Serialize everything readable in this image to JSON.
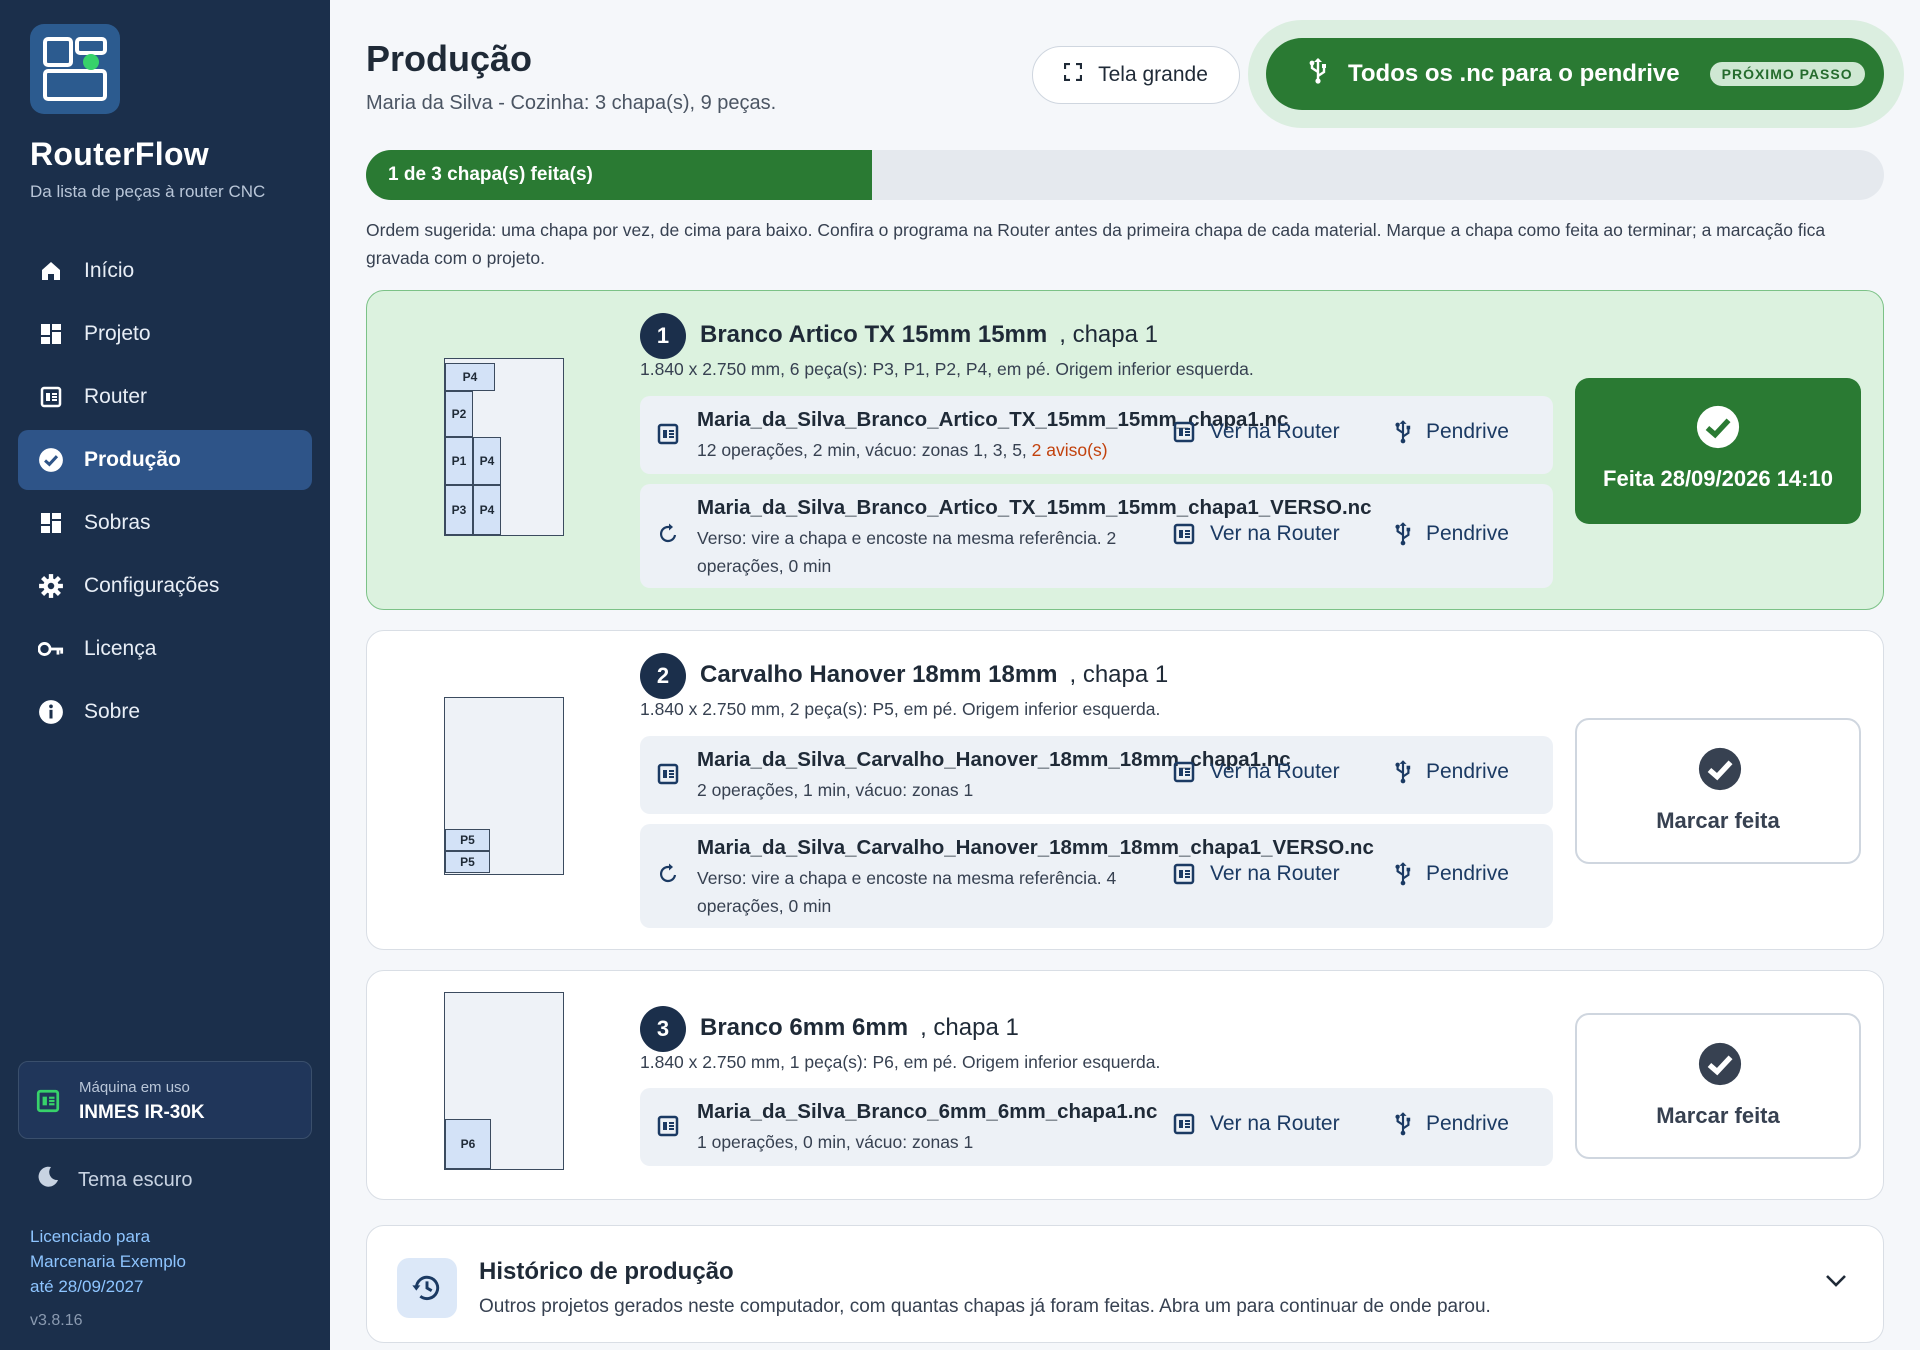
{
  "sidebar": {
    "brand": "RouterFlow",
    "tagline": "Da lista de peças à router CNC",
    "items": [
      {
        "label": "Início",
        "icon": "home-icon"
      },
      {
        "label": "Projeto",
        "icon": "dashboard-icon"
      },
      {
        "label": "Router",
        "icon": "router-icon"
      },
      {
        "label": "Produção",
        "icon": "check-circle-icon",
        "active": true
      },
      {
        "label": "Sobras",
        "icon": "grid-icon"
      },
      {
        "label": "Configurações",
        "icon": "gear-icon"
      },
      {
        "label": "Licença",
        "icon": "key-icon"
      },
      {
        "label": "Sobre",
        "icon": "info-icon"
      }
    ],
    "machine_label": "Máquina em uso",
    "machine_value": "INMES IR-30K",
    "theme_label": "Tema escuro",
    "license_lines": [
      "Licenciado para",
      "Marcenaria Exemplo",
      "até 28/09/2027"
    ],
    "version": "v3.8.16"
  },
  "header": {
    "title": "Produção",
    "subtitle": "Maria da Silva - Cozinha: 3 chapa(s), 9 peças.",
    "tela_grande": "Tela grande",
    "next_label": "Todos os .nc para o pendrive",
    "next_badge": "PRÓXIMO PASSO"
  },
  "progress": {
    "text": "1 de 3 chapa(s) feita(s)",
    "done": 1,
    "total": 3
  },
  "hint": "Ordem sugerida: uma chapa por vez, de cima para baixo. Confira o programa na Router antes da primeira chapa de cada material. Marque a chapa como feita ao terminar; a marcação fica gravada com o projeto.",
  "actions": {
    "view": "Ver na Router",
    "pendrive": "Pendrive"
  },
  "sheets": [
    {
      "num": "1",
      "material": "Branco Artico TX 15mm 15mm",
      "chapa": ", chapa 1",
      "desc": "1.840 x 2.750 mm, 6 peça(s): P3, P1, P2, P4, em pé. Origem inferior esquerda.",
      "pieces": [
        "P4",
        "P2",
        "P1",
        "P4",
        "P3",
        "P4"
      ],
      "files": [
        {
          "name": "Maria_da_Silva_Branco_Artico_TX_15mm_15mm_chapa1.nc",
          "desc": "12 operações, 2 min, vácuo: zonas 1, 3, 5,",
          "warn": "2 aviso(s)"
        },
        {
          "name": "Maria_da_Silva_Branco_Artico_TX_15mm_15mm_chapa1_VERSO.nc",
          "desc": "Verso: vire a chapa e encoste na mesma referência. 2 operações, 0 min"
        }
      ],
      "status": "Feita 28/09/2026 14:10",
      "done": true
    },
    {
      "num": "2",
      "material": "Carvalho Hanover 18mm 18mm",
      "chapa": ", chapa 1",
      "desc": "1.840 x 2.750 mm, 2 peça(s): P5, em pé. Origem inferior esquerda.",
      "pieces": [
        "P5",
        "P5"
      ],
      "files": [
        {
          "name": "Maria_da_Silva_Carvalho_Hanover_18mm_18mm_chapa1.nc",
          "desc": "2 operações, 1 min, vácuo: zonas 1"
        },
        {
          "name": "Maria_da_Silva_Carvalho_Hanover_18mm_18mm_chapa1_VERSO.nc",
          "desc": "Verso: vire a chapa e encoste na mesma referência. 4 operações, 0 min"
        }
      ],
      "status": "Marcar feita",
      "done": false
    },
    {
      "num": "3",
      "material": "Branco 6mm 6mm",
      "chapa": ", chapa 1",
      "desc": "1.840 x 2.750 mm, 1 peça(s): P6, em pé. Origem inferior esquerda.",
      "pieces": [
        "P6"
      ],
      "files": [
        {
          "name": "Maria_da_Silva_Branco_6mm_6mm_chapa1.nc",
          "desc": "1 operações, 0 min, vácuo: zonas 1"
        }
      ],
      "status": "Marcar feita",
      "done": false
    }
  ],
  "history": {
    "title": "Histórico de produção",
    "desc": "Outros projetos gerados neste computador, com quantas chapas já foram feitas. Abra um para continuar de onde parou."
  },
  "colors": {
    "sidebar_bg": "#1b2f4b",
    "active_nav": "#2e5488",
    "success": "#2a7a33",
    "done_card_bg": "#dcf2df",
    "warning": "#c2410c"
  }
}
